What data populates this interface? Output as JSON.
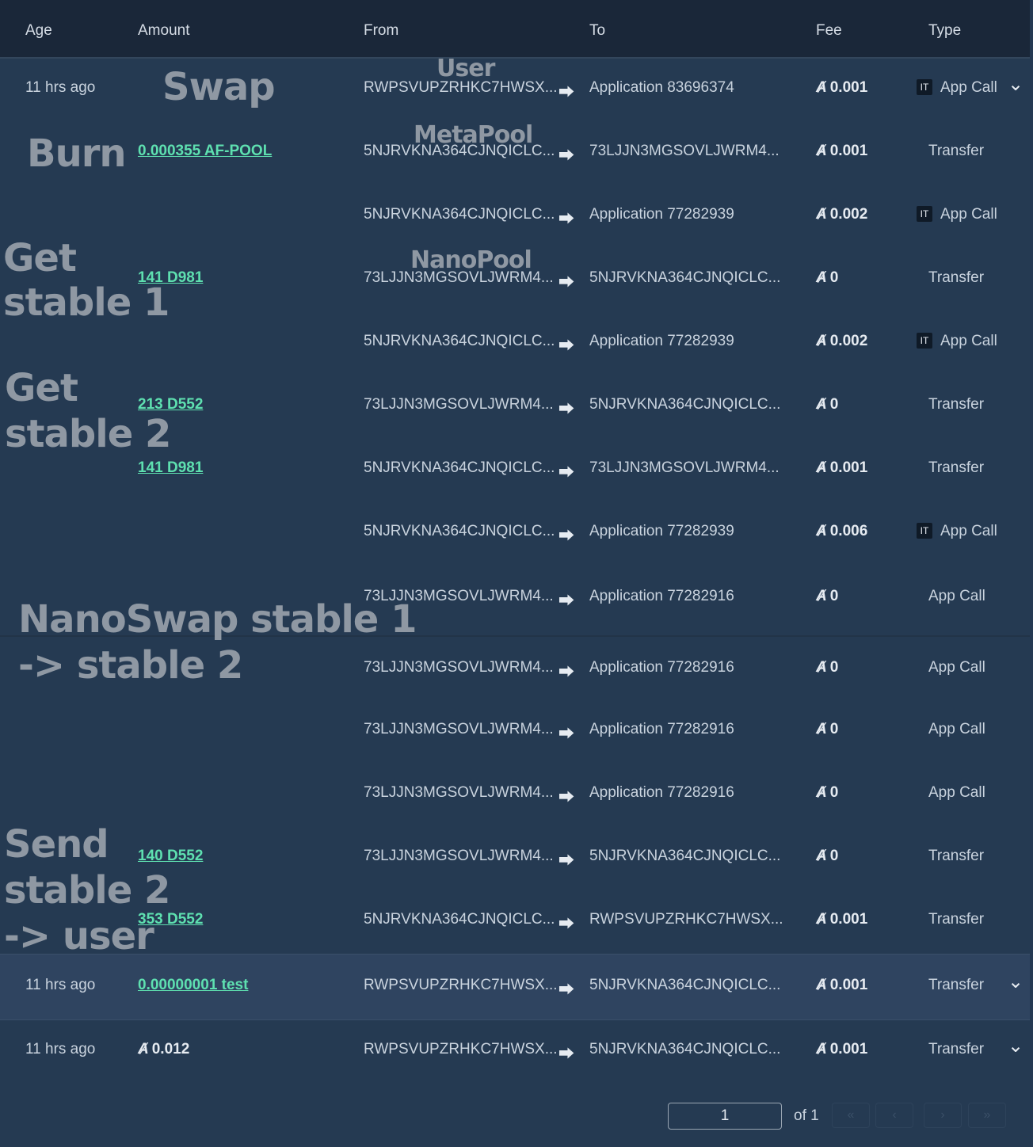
{
  "header": {
    "age": "Age",
    "amount": "Amount",
    "from": "From",
    "to": "To",
    "fee": "Fee",
    "type": "Type"
  },
  "algo_symbol": "Ⱥ",
  "arrow_symbol": "⮕",
  "rows": [
    {
      "age": "11 hrs ago",
      "amount": "",
      "from": "RWPSVUPZRHKC7HWSX...",
      "to": "Application 83696374",
      "fee": "0.001",
      "type": "App Call",
      "badge": "IT",
      "chevron": true
    },
    {
      "age": "",
      "amount": "0.000355 AF-POOL",
      "from": "5NJRVKNA364CJNQICLC...",
      "to": "73LJJN3MGSOVLJWRM4...",
      "fee": "0.001",
      "type": "Transfer"
    },
    {
      "age": "",
      "amount": "",
      "from": "5NJRVKNA364CJNQICLC...",
      "to": "Application 77282939",
      "fee": "0.002",
      "type": "App Call",
      "badge": "IT"
    },
    {
      "age": "",
      "amount": "141 D981",
      "from": "73LJJN3MGSOVLJWRM4...",
      "to": "5NJRVKNA364CJNQICLC...",
      "fee": "0",
      "type": "Transfer"
    },
    {
      "age": "",
      "amount": "",
      "from": "5NJRVKNA364CJNQICLC...",
      "to": "Application 77282939",
      "fee": "0.002",
      "type": "App Call",
      "badge": "IT"
    },
    {
      "age": "",
      "amount": "213 D552",
      "from": "73LJJN3MGSOVLJWRM4...",
      "to": "5NJRVKNA364CJNQICLC...",
      "fee": "0",
      "type": "Transfer"
    },
    {
      "age": "",
      "amount": "141 D981",
      "from": "5NJRVKNA364CJNQICLC...",
      "to": "73LJJN3MGSOVLJWRM4...",
      "fee": "0.001",
      "type": "Transfer"
    },
    {
      "age": "",
      "amount": "",
      "from": "5NJRVKNA364CJNQICLC...",
      "to": "Application 77282939",
      "fee": "0.006",
      "type": "App Call",
      "badge": "IT"
    },
    {
      "age": "",
      "amount": "",
      "from": "73LJJN3MGSOVLJWRM4...",
      "to": "Application 77282916",
      "fee": "0",
      "type": "App Call"
    },
    {
      "age": "",
      "amount": "",
      "from": "73LJJN3MGSOVLJWRM4...",
      "to": "Application 77282916",
      "fee": "0",
      "type": "App Call"
    },
    {
      "age": "",
      "amount": "",
      "from": "73LJJN3MGSOVLJWRM4...",
      "to": "Application 77282916",
      "fee": "0",
      "type": "App Call"
    },
    {
      "age": "",
      "amount": "",
      "from": "73LJJN3MGSOVLJWRM4...",
      "to": "Application 77282916",
      "fee": "0",
      "type": "App Call"
    },
    {
      "age": "",
      "amount": "140 D552",
      "from": "73LJJN3MGSOVLJWRM4...",
      "to": "5NJRVKNA364CJNQICLC...",
      "fee": "0",
      "type": "Transfer"
    },
    {
      "age": "",
      "amount": "353 D552",
      "from": "5NJRVKNA364CJNQICLC...",
      "to": "RWPSVUPZRHKC7HWSX...",
      "fee": "0.001",
      "type": "Transfer"
    },
    {
      "age": "11 hrs ago",
      "amount": "0.00000001 test",
      "from": "RWPSVUPZRHKC7HWSX...",
      "to": "5NJRVKNA364CJNQICLC...",
      "fee": "0.001",
      "type": "Transfer",
      "chevron": true,
      "selected": true
    },
    {
      "age": "11 hrs ago",
      "amount": "0.012",
      "amount_algo": true,
      "from": "RWPSVUPZRHKC7HWSX...",
      "to": "5NJRVKNA364CJNQICLC...",
      "fee": "0.001",
      "type": "Transfer",
      "chevron": true
    }
  ],
  "annotations": {
    "user": "User",
    "swap": "Swap",
    "metapool": "MetaPool",
    "burn": "Burn",
    "nanopool": "NanoPool",
    "get_stable_1_a": "Get",
    "get_stable_1_b": "stable 1",
    "get_stable_2_a": "Get",
    "get_stable_2_b": "stable 2",
    "nanoswap_a": "NanoSwap stable 1",
    "nanoswap_b": "-> stable 2",
    "send_a": "Send",
    "send_b": "stable 2",
    "send_c": "-> user"
  },
  "pagination": {
    "page": "1",
    "of_label": "of 1",
    "first": "«",
    "prev": "‹",
    "next": "›",
    "last": "»"
  }
}
